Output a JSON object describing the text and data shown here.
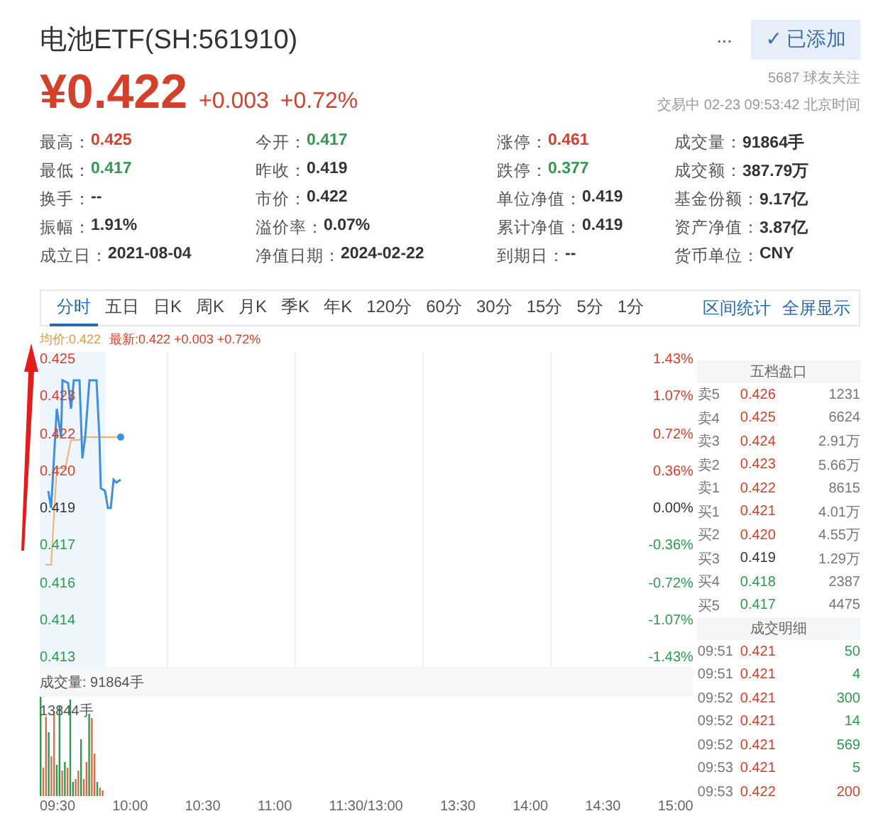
{
  "header": {
    "title": "电池ETF(SH:561910)",
    "more": "···",
    "follow_button": {
      "check": "✓",
      "label": "已添加"
    },
    "price": "¥0.422",
    "change": "+0.003",
    "change_pct": "+0.72%",
    "followers": "5687 球友关注",
    "status": "交易中 02-23 09:53:42 北京时间"
  },
  "stats": [
    [
      {
        "label": "最高：",
        "value": "0.425",
        "color": "#d4402a"
      },
      {
        "label": "今开：",
        "value": "0.417",
        "color": "#2f9950"
      },
      {
        "label": "涨停：",
        "value": "0.461",
        "color": "#d4402a"
      },
      {
        "label": "成交量：",
        "value": "91864手",
        "color": "#333333"
      }
    ],
    [
      {
        "label": "最低：",
        "value": "0.417",
        "color": "#2f9950"
      },
      {
        "label": "昨收：",
        "value": "0.419",
        "color": "#333333"
      },
      {
        "label": "跌停：",
        "value": "0.377",
        "color": "#2f9950"
      },
      {
        "label": "成交额：",
        "value": "387.79万",
        "color": "#333333"
      }
    ],
    [
      {
        "label": "换手：",
        "value": "--",
        "color": "#333333"
      },
      {
        "label": "市价：",
        "value": "0.422",
        "color": "#333333"
      },
      {
        "label": "单位净值：",
        "value": "0.419",
        "color": "#333333"
      },
      {
        "label": "基金份额：",
        "value": "9.17亿",
        "color": "#333333"
      }
    ],
    [
      {
        "label": "振幅：",
        "value": "1.91%",
        "color": "#333333"
      },
      {
        "label": "溢价率：",
        "value": "0.07%",
        "color": "#333333"
      },
      {
        "label": "累计净值：",
        "value": "0.419",
        "color": "#333333"
      },
      {
        "label": "资产净值：",
        "value": "3.87亿",
        "color": "#333333"
      }
    ],
    [
      {
        "label": "成立日：",
        "value": "2021-08-04",
        "color": "#333333"
      },
      {
        "label": "净值日期：",
        "value": "2024-02-22",
        "color": "#333333"
      },
      {
        "label": "到期日：",
        "value": "--",
        "color": "#333333"
      },
      {
        "label": "货币单位：",
        "value": "CNY",
        "color": "#333333"
      }
    ]
  ],
  "tabs": [
    {
      "label": "分时",
      "selected": true
    },
    {
      "label": "五日",
      "selected": false
    },
    {
      "label": "日K",
      "selected": false
    },
    {
      "label": "周K",
      "selected": false
    },
    {
      "label": "月K",
      "selected": false
    },
    {
      "label": "季K",
      "selected": false
    },
    {
      "label": "年K",
      "selected": false
    },
    {
      "label": "120分",
      "selected": false
    },
    {
      "label": "60分",
      "selected": false
    },
    {
      "label": "30分",
      "selected": false
    },
    {
      "label": "15分",
      "selected": false
    },
    {
      "label": "5分",
      "selected": false
    },
    {
      "label": "1分",
      "selected": false
    }
  ],
  "tab_links": [
    "区间统计",
    "全屏显示"
  ],
  "legend": {
    "avg": "均价:0.422",
    "latest": "最新:0.422 +0.003 +0.72%"
  },
  "price_axis": [
    {
      "text": "0.425",
      "color": "#d4402a"
    },
    {
      "text": "0.423",
      "color": "#d4402a"
    },
    {
      "text": "0.422",
      "color": "#d4402a"
    },
    {
      "text": "0.420",
      "color": "#d4402a"
    },
    {
      "text": "0.419",
      "color": "#333333"
    },
    {
      "text": "0.417",
      "color": "#2f9950"
    },
    {
      "text": "0.416",
      "color": "#2f9950"
    },
    {
      "text": "0.414",
      "color": "#2f9950"
    },
    {
      "text": "0.413",
      "color": "#2f9950"
    }
  ],
  "pct_axis": [
    {
      "text": "1.43%",
      "color": "#d4402a"
    },
    {
      "text": "1.07%",
      "color": "#d4402a"
    },
    {
      "text": "0.72%",
      "color": "#d4402a"
    },
    {
      "text": "0.36%",
      "color": "#d4402a"
    },
    {
      "text": "0.00%",
      "color": "#333333"
    },
    {
      "text": "-0.36%",
      "color": "#2f9950"
    },
    {
      "text": "-0.72%",
      "color": "#2f9950"
    },
    {
      "text": "-1.07%",
      "color": "#2f9950"
    },
    {
      "text": "-1.43%",
      "color": "#2f9950"
    }
  ],
  "volume": {
    "label": "成交量: 91864手",
    "max": "13844手"
  },
  "time_axis": [
    "09:30",
    "10:00",
    "10:30",
    "11:00",
    "11:30/13:00",
    "13:30",
    "14:00",
    "14:30",
    "15:00"
  ],
  "order_book": {
    "title": "五档盘口",
    "rows": [
      {
        "side": "卖5",
        "price": "0.426",
        "color": "#d4402a",
        "volume": "1231"
      },
      {
        "side": "卖4",
        "price": "0.425",
        "color": "#d4402a",
        "volume": "6624"
      },
      {
        "side": "卖3",
        "price": "0.424",
        "color": "#d4402a",
        "volume": "2.91万"
      },
      {
        "side": "卖2",
        "price": "0.423",
        "color": "#d4402a",
        "volume": "5.66万"
      },
      {
        "side": "卖1",
        "price": "0.422",
        "color": "#d4402a",
        "volume": "8615"
      },
      {
        "side": "买1",
        "price": "0.421",
        "color": "#d4402a",
        "volume": "4.01万"
      },
      {
        "side": "买2",
        "price": "0.420",
        "color": "#d4402a",
        "volume": "4.55万"
      },
      {
        "side": "买3",
        "price": "0.419",
        "color": "#333333",
        "volume": "1.29万"
      },
      {
        "side": "买4",
        "price": "0.418",
        "color": "#2f9950",
        "volume": "2387"
      },
      {
        "side": "买5",
        "price": "0.417",
        "color": "#2f9950",
        "volume": "4475"
      }
    ]
  },
  "trades": {
    "title": "成交明细",
    "rows": [
      {
        "time": "09:51",
        "price": {
          "text": "0.421",
          "color": "#d4402a"
        },
        "volume": {
          "text": "50",
          "color": "#2f9950"
        }
      },
      {
        "time": "09:51",
        "price": {
          "text": "0.421",
          "color": "#d4402a"
        },
        "volume": {
          "text": "4",
          "color": "#2f9950"
        }
      },
      {
        "time": "09:52",
        "price": {
          "text": "0.421",
          "color": "#d4402a"
        },
        "volume": {
          "text": "300",
          "color": "#2f9950"
        }
      },
      {
        "time": "09:52",
        "price": {
          "text": "0.421",
          "color": "#d4402a"
        },
        "volume": {
          "text": "14",
          "color": "#2f9950"
        }
      },
      {
        "time": "09:52",
        "price": {
          "text": "0.421",
          "color": "#d4402a"
        },
        "volume": {
          "text": "569",
          "color": "#2f9950"
        }
      },
      {
        "time": "09:53",
        "price": {
          "text": "0.421",
          "color": "#d4402a"
        },
        "volume": {
          "text": "5",
          "color": "#2f9950"
        }
      },
      {
        "time": "09:53",
        "price": {
          "text": "0.422",
          "color": "#d4402a"
        },
        "volume": {
          "text": "200",
          "color": "#d4402a"
        }
      }
    ]
  }
}
